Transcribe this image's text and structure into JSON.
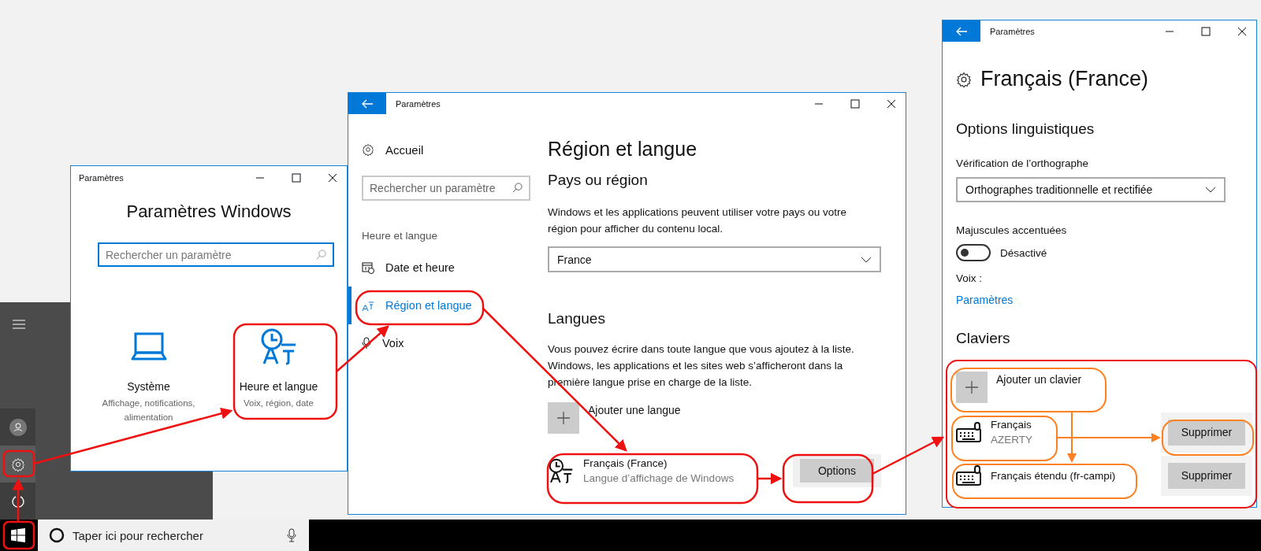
{
  "settings_home": {
    "title": "Paramètres",
    "heading": "Paramètres Windows",
    "search_placeholder": "Rechercher un paramètre",
    "tiles": [
      {
        "kind": "laptop",
        "name": "Système",
        "description": "Affichage, notifications, alimentation"
      },
      {
        "kind": "time-language",
        "name": "Heure et langue",
        "description": "Voix, région, date"
      }
    ]
  },
  "region_window": {
    "title": "Paramètres",
    "home": "Accueil",
    "search_placeholder": "Rechercher un paramètre",
    "section": "Heure et langue",
    "nav": [
      {
        "kind": "calendar",
        "label": "Date et heure",
        "selected": false
      },
      {
        "kind": "language",
        "label": "Région et langue",
        "selected": true
      },
      {
        "kind": "mic",
        "label": "Voix",
        "selected": false
      }
    ],
    "heading": "Région et langue",
    "country_heading": "Pays ou région",
    "country_text": "Windows et les applications peuvent utiliser votre pays ou votre région pour afficher du contenu local.",
    "country_value": "France",
    "languages_heading": "Langues",
    "languages_text": "Vous pouvez écrire dans toute langue que vous ajoutez à la liste. Windows, les applications et les sites web s’afficheront dans la première langue prise en charge de la liste.",
    "add_language": "Ajouter une langue",
    "languages": [
      {
        "name": "Français (France)",
        "detail": "Langue d’affichage de Windows",
        "button": "Options"
      }
    ]
  },
  "language_window": {
    "title": "Paramètres",
    "heading": "Français (France)",
    "options_heading": "Options linguistiques",
    "spelling_label": "Vérification de l’orthographe",
    "spelling_value": "Orthographes traditionnelle et rectifiée",
    "accents_label": "Majuscules accentuées",
    "accents": {
      "on": false,
      "state_label": "Désactivé"
    },
    "voice_label": "Voix :",
    "voice_link": "Paramètres",
    "keyboards_heading": "Claviers",
    "add_keyboard": "Ajouter un clavier",
    "keyboards": [
      {
        "name": "Français",
        "layout": "AZERTY",
        "button": "Supprimer"
      },
      {
        "name": "Français étendu (fr-campi)",
        "button": "Supprimer"
      }
    ]
  },
  "taskbar": {
    "search_placeholder": "Taper ici pour rechercher"
  }
}
